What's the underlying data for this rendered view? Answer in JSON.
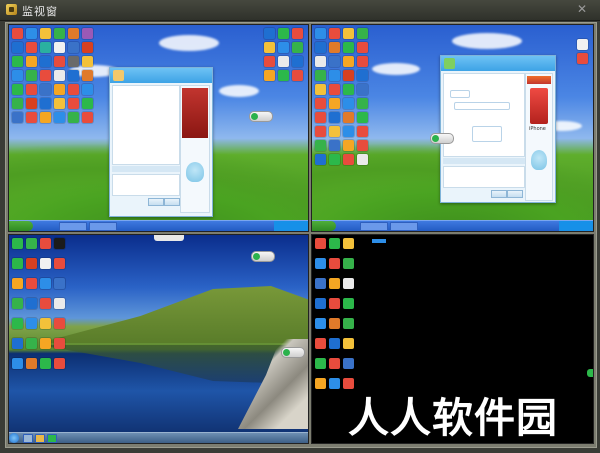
{
  "window": {
    "title": "监视窗",
    "close_symbol": "✕"
  },
  "icons": {
    "app": "eye-icon",
    "close": "close-icon"
  },
  "screens": [
    {
      "id": "screen-1",
      "wallpaper": "bliss",
      "chat_window": {
        "has_ad_image": true
      },
      "tray_time": ""
    },
    {
      "id": "screen-2",
      "wallpaper": "bliss",
      "chat_window": {
        "ad_caption": "iPhone"
      },
      "tray_time": ""
    },
    {
      "id": "screen-3",
      "wallpaper": "mountain-lake"
    },
    {
      "id": "screen-4",
      "wallpaper": "black"
    }
  ],
  "watermark": "人人软件园",
  "colors": {
    "title_bar": "#3a3c35",
    "frame": "#7c7d70",
    "xp_taskbar": "#235bc2",
    "watermark": "#ffffff"
  }
}
